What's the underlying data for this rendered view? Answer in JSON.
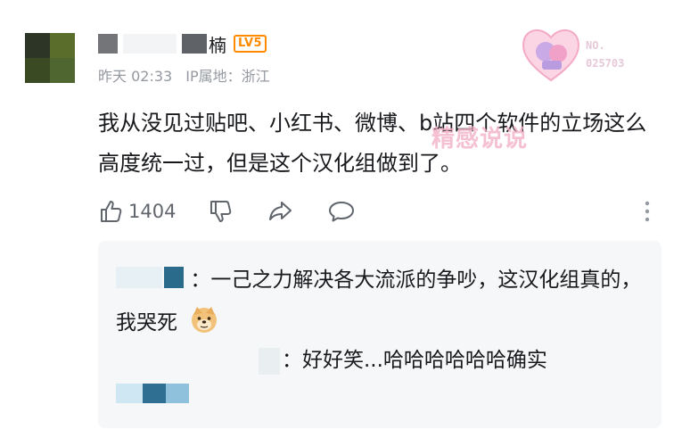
{
  "comment": {
    "username_tail": "楠",
    "level_badge": "LV5",
    "time": "昨天 02:33",
    "ip_location": "IP属地：浙江",
    "text": "我从没见过贴吧、小红书、微博、b站四个软件的立场这么高度统一过，但是这个汉化组做到了。",
    "like_count": "1404",
    "fan_badge_number": "NO.\n025703",
    "watermark": "精感说说"
  },
  "replies": [
    {
      "text": "：一己之力解决各大流派的争吵，这汉化组真的，我哭死"
    },
    {
      "text": "：好好笑...哈哈哈哈哈哈确实"
    }
  ],
  "icons": {
    "like": "thumbs-up-icon",
    "dislike": "thumbs-down-icon",
    "share": "share-icon",
    "reply": "comment-bubble-icon",
    "more": "more-vertical-icon",
    "emoji": "doge-emoji-icon"
  },
  "colors": {
    "level": "#ff8a00",
    "meta": "#9499a0",
    "link": "#2aa3d8",
    "reply_bg": "#f6f7f8"
  }
}
